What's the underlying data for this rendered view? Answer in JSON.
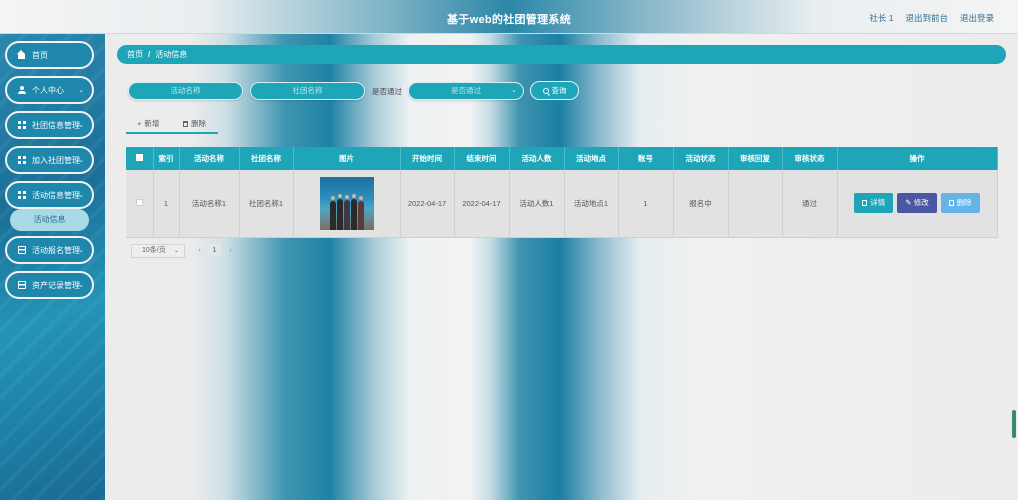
{
  "header": {
    "title": "基于web的社团管理系统",
    "links": [
      "社长 1",
      "退出到前台",
      "退出登录"
    ]
  },
  "sidebar": {
    "items": [
      {
        "label": "首页",
        "icon": "home-icon",
        "has_children": false
      },
      {
        "label": "个人中心",
        "icon": "user-icon",
        "has_children": true
      },
      {
        "label": "社团信息管理",
        "icon": "grid-icon",
        "has_children": true
      },
      {
        "label": "加入社团管理",
        "icon": "grid-icon",
        "has_children": true
      },
      {
        "label": "活动信息管理",
        "icon": "grid-icon",
        "has_children": true
      },
      {
        "label": "活动报名管理",
        "icon": "card-icon",
        "has_children": true
      },
      {
        "label": "资产记录管理",
        "icon": "card-icon",
        "has_children": true
      }
    ],
    "active_submenu": "活动信息"
  },
  "breadcrumb": {
    "home": "首页",
    "separator": "/",
    "current": "活动信息"
  },
  "search": {
    "activity_name_placeholder": "活动名称",
    "club_name_placeholder": "社团名称",
    "approved_label": "是否通过",
    "approved_select_placeholder": "是否通过",
    "query_label": "查询"
  },
  "actions": {
    "add_label": "新增",
    "delete_label": "删除"
  },
  "table": {
    "columns": [
      "索引",
      "活动名称",
      "社团名称",
      "图片",
      "开始时间",
      "结束时间",
      "活动人数",
      "活动地点",
      "账号",
      "活动状态",
      "审核回复",
      "审核状态",
      "操作"
    ],
    "rows": [
      {
        "index": "1",
        "activity_name": "活动名称1",
        "club_name": "社团名称1",
        "start_time": "2022-04-17",
        "end_time": "2022-04-17",
        "participants": "活动人数1",
        "location": "活动地点1",
        "account": "1",
        "status": "报名中",
        "review_reply": "",
        "review_status": "通过"
      }
    ],
    "row_buttons": {
      "detail": "详情",
      "edit": "修改",
      "delete": "删除"
    }
  },
  "pagination": {
    "page_size": "10条/页",
    "prev": "‹",
    "current_page": "1",
    "next": "›"
  },
  "colors": {
    "accent": "#1ea6b8",
    "edit_button": "#4a58a4",
    "delete_button": "#64b4e8",
    "sidebar": "#1e87ab"
  }
}
